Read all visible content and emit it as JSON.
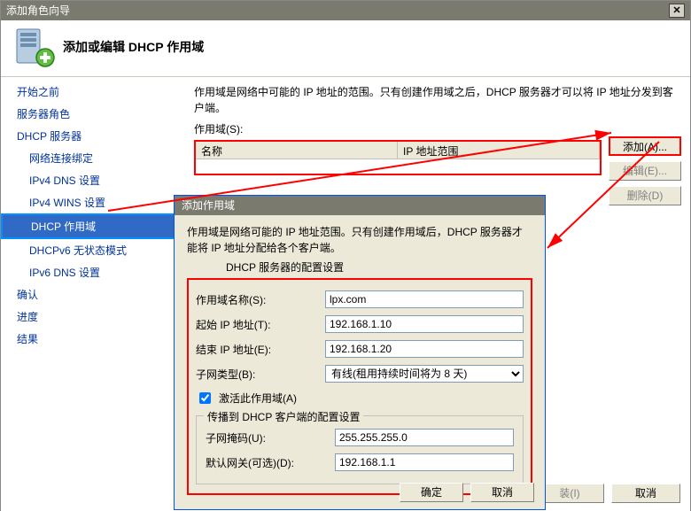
{
  "window": {
    "title": "添加角色向导"
  },
  "header": {
    "title": "添加或编辑 DHCP 作用域"
  },
  "sidebar": {
    "items": [
      "开始之前",
      "服务器角色",
      "DHCP 服务器",
      "网络连接绑定",
      "IPv4 DNS 设置",
      "IPv4 WINS 设置",
      "DHCP 作用域",
      "DHCPv6 无状态模式",
      "IPv6 DNS 设置",
      "确认",
      "进度",
      "结果"
    ]
  },
  "content": {
    "desc": "作用域是网络中可能的 IP 地址的范围。只有创建作用域之后，DHCP 服务器才可以将 IP 地址分发到客户端。",
    "list_label": "作用域(S):",
    "columns": {
      "name": "名称",
      "range": "IP 地址范围"
    },
    "buttons": {
      "add": "添加(A)...",
      "edit": "编辑(E)...",
      "delete": "删除(D)"
    }
  },
  "dialog": {
    "title": "添加作用域",
    "desc": "作用域是网络可能的 IP 地址范围。只有创建作用域后，DHCP 服务器才能将 IP 地址分配给各个客户端。",
    "group_label": "DHCP 服务器的配置设置",
    "fields": {
      "scope_name": {
        "label": "作用域名称(S):",
        "value": "lpx.com"
      },
      "start_ip": {
        "label": "起始 IP 地址(T):",
        "value": "192.168.1.10"
      },
      "end_ip": {
        "label": "结束 IP 地址(E):",
        "value": "192.168.1.20"
      },
      "subnet_type": {
        "label": "子网类型(B):",
        "value": "有线(租用持续时间将为 8 天)"
      },
      "activate": {
        "label": "激活此作用域(A)"
      },
      "subnet_mask": {
        "label": "子网掩码(U):",
        "value": "255.255.255.0"
      },
      "gateway": {
        "label": "默认网关(可选)(D):",
        "value": "192.168.1.1"
      }
    },
    "propagate_group": "传播到 DHCP 客户端的配置设置",
    "buttons": {
      "ok": "确定",
      "cancel": "取消"
    }
  },
  "footer": {
    "install": "装(I)",
    "cancel": "取消"
  }
}
